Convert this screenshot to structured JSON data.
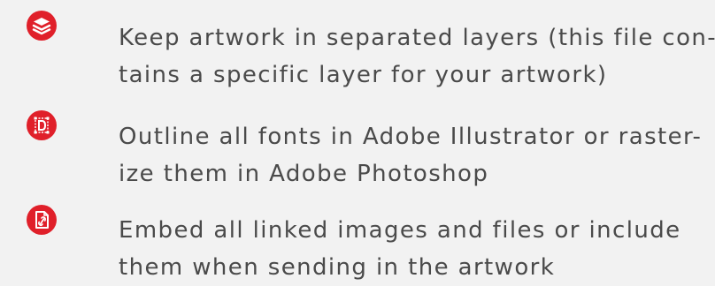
{
  "accent_color": "#e0202a",
  "text_color": "#4a4a4a",
  "background_color": "#f2f2f2",
  "items": [
    {
      "icon": "layers-icon",
      "lines": [
        "Keep artwork in separated layers (this file con-",
        "tains a specific layer for your artwork)"
      ]
    },
    {
      "icon": "text-outline-icon",
      "lines": [
        "Outline all fonts in Adobe Illustrator or raster-",
        "ize them in Adobe Photoshop"
      ]
    },
    {
      "icon": "embed-link-file-icon",
      "lines": [
        "Embed all linked images and files or include",
        "them when sending in the artwork"
      ]
    }
  ]
}
